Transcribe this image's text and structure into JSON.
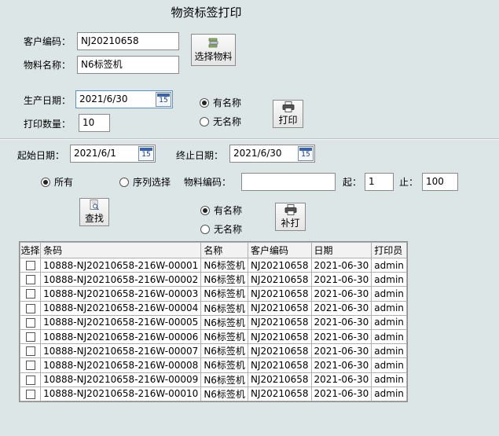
{
  "title": "物资标签打印",
  "customer_code": {
    "label": "客户编码：",
    "value": "NJ20210658"
  },
  "material_name": {
    "label": "物料名称：",
    "value": "N6标签机"
  },
  "select_material_button": "选择物料",
  "production_date": {
    "label": "生产日期：",
    "value": "2021/6/30"
  },
  "print_quantity": {
    "label": "打印数量：",
    "value": "10"
  },
  "name_radio_top": {
    "with_name": "有名称",
    "without_name": "无名称",
    "selected": "with_name"
  },
  "print_button": "打印",
  "start_date": {
    "label": "起始日期：",
    "value": "2021/6/1"
  },
  "end_date": {
    "label": "终止日期：",
    "value": "2021/6/30"
  },
  "calendar_icon_text": "15",
  "filter": {
    "all_label": "所有",
    "sequence_label": "序列选择",
    "selected": "all",
    "material_code_label": "物料编码：",
    "material_code_value": "",
    "from_label": "起：",
    "from_value": "1",
    "to_label": "止：",
    "to_value": "100"
  },
  "search_button": "查找",
  "name_radio_bottom": {
    "with_name": "有名称",
    "without_name": "无名称",
    "selected": "with_name"
  },
  "reprint_button": "补打",
  "table": {
    "headers": [
      "选择",
      "条码",
      "名称",
      "客户编码",
      "日期",
      "打印员"
    ],
    "rows": [
      [
        "",
        "10888-NJ20210658-216W-00001",
        "N6标签机",
        "NJ20210658",
        "2021-06-30",
        "admin"
      ],
      [
        "",
        "10888-NJ20210658-216W-00002",
        "N6标签机",
        "NJ20210658",
        "2021-06-30",
        "admin"
      ],
      [
        "",
        "10888-NJ20210658-216W-00003",
        "N6标签机",
        "NJ20210658",
        "2021-06-30",
        "admin"
      ],
      [
        "",
        "10888-NJ20210658-216W-00004",
        "N6标签机",
        "NJ20210658",
        "2021-06-30",
        "admin"
      ],
      [
        "",
        "10888-NJ20210658-216W-00005",
        "N6标签机",
        "NJ20210658",
        "2021-06-30",
        "admin"
      ],
      [
        "",
        "10888-NJ20210658-216W-00006",
        "N6标签机",
        "NJ20210658",
        "2021-06-30",
        "admin"
      ],
      [
        "",
        "10888-NJ20210658-216W-00007",
        "N6标签机",
        "NJ20210658",
        "2021-06-30",
        "admin"
      ],
      [
        "",
        "10888-NJ20210658-216W-00008",
        "N6标签机",
        "NJ20210658",
        "2021-06-30",
        "admin"
      ],
      [
        "",
        "10888-NJ20210658-216W-00009",
        "N6标签机",
        "NJ20210658",
        "2021-06-30",
        "admin"
      ],
      [
        "",
        "10888-NJ20210658-216W-00010",
        "N6标签机",
        "NJ20210658",
        "2021-06-30",
        "admin"
      ]
    ]
  }
}
